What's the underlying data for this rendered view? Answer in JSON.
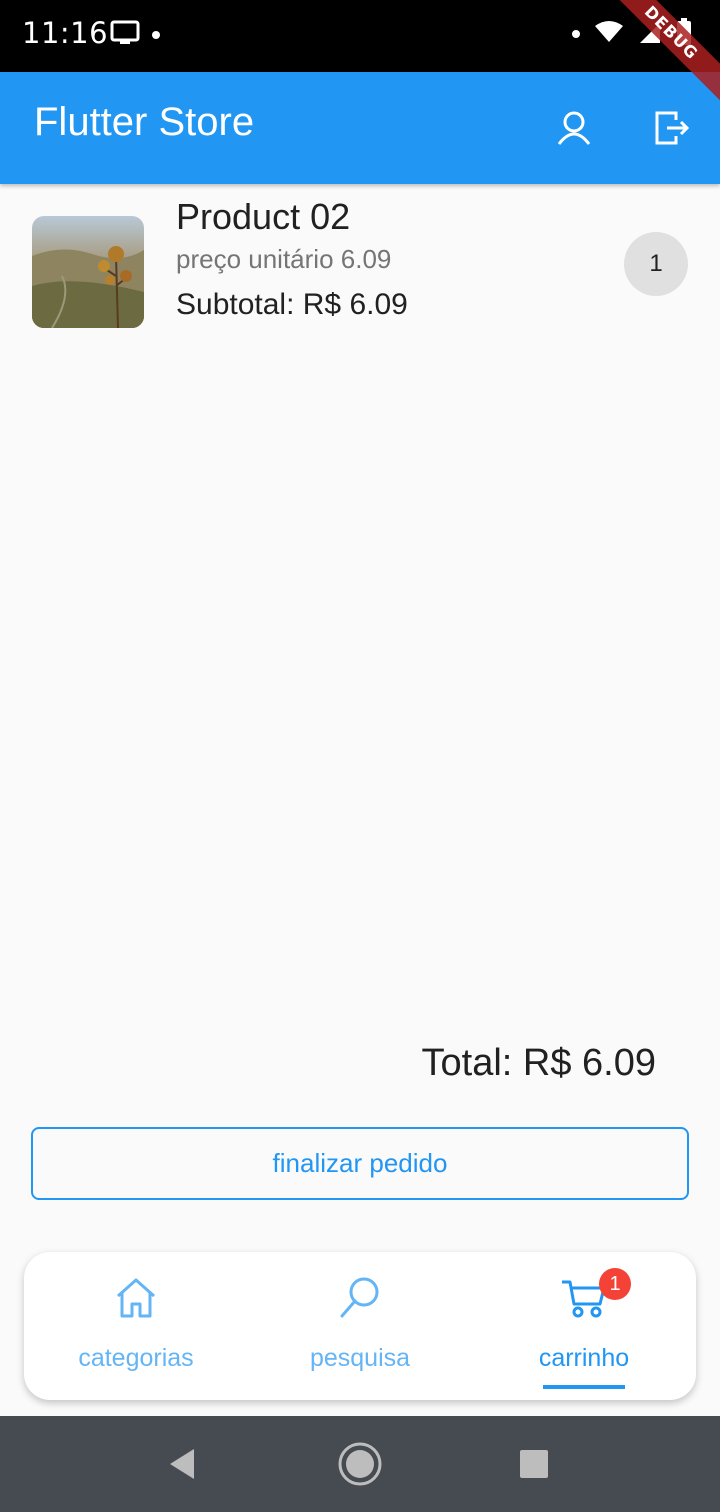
{
  "status_bar": {
    "time": "11:16",
    "icons": [
      "cast-icon",
      "wifi-icon",
      "signal-icon",
      "battery-icon"
    ],
    "debug_label": "DEBUG"
  },
  "app_bar": {
    "title": "Flutter Store",
    "actions": [
      "account-icon",
      "logout-icon"
    ],
    "background_color": "#2196f3"
  },
  "cart": {
    "items": [
      {
        "title": "Product 02",
        "unit_price_label": "preço unitário 6.09",
        "subtotal_label": "Subtotal: R$ 6.09",
        "quantity": "1"
      }
    ],
    "total_label": "Total: R$ 6.09",
    "checkout_label": "finalizar pedido"
  },
  "bottom_nav": {
    "items": [
      {
        "label": "categorias",
        "icon": "home-icon"
      },
      {
        "label": "pesquisa",
        "icon": "search-icon"
      },
      {
        "label": "carrinho",
        "icon": "cart-icon",
        "badge": "1",
        "active": true
      }
    ],
    "active_color": "#2196f3",
    "inactive_color": "#64b5f6"
  },
  "system_nav": {
    "buttons": [
      "back-icon",
      "home-circle-icon",
      "recents-icon"
    ]
  }
}
